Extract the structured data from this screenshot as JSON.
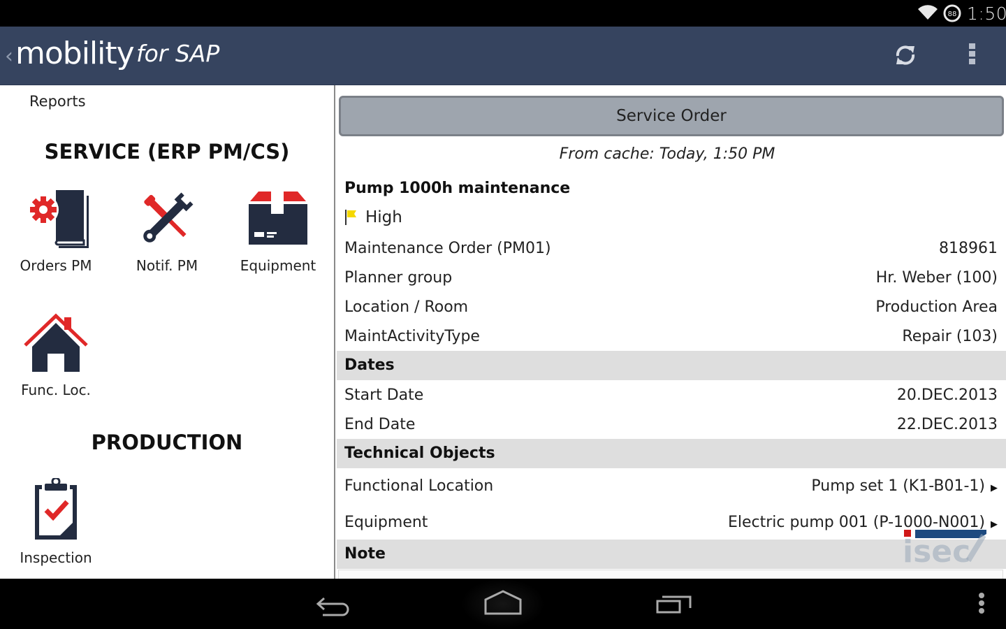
{
  "status_bar": {
    "time": "1:50",
    "battery_level": "88",
    "wifi_icon": "wifi-icon",
    "battery_icon": "battery-circle-icon"
  },
  "action_bar": {
    "back_glyph": "‹",
    "app_name": "mobility",
    "app_suffix": "for SAP",
    "refresh_icon": "refresh-icon",
    "overflow_icon": "more-vertical-icon"
  },
  "left_panel": {
    "reports_label": "Reports",
    "sections": [
      {
        "title": "SERVICE (ERP PM/CS)",
        "tiles": [
          {
            "label": "Orders PM",
            "icon": "orders-gear-book-icon"
          },
          {
            "label": "Notif. PM",
            "icon": "wrench-screwdriver-icon"
          },
          {
            "label": "Equipment",
            "icon": "package-box-icon"
          },
          {
            "label": "Func. Loc.",
            "icon": "house-icon"
          }
        ]
      },
      {
        "title": "PRODUCTION",
        "tiles": [
          {
            "label": "Inspection",
            "icon": "clipboard-check-icon"
          }
        ]
      }
    ]
  },
  "detail": {
    "service_order_button": "Service Order",
    "cache_text": "From cache: Today, 1:50 PM",
    "order_title": "Pump 1000h maintenance",
    "priority": {
      "label": "High",
      "icon": "yellow-flag-icon",
      "color": "#f5d800"
    },
    "fields": [
      {
        "label": "Maintenance Order (PM01)",
        "value": "818961"
      },
      {
        "label": "Planner group",
        "value": "Hr. Weber (100)"
      },
      {
        "label": "Location / Room",
        "value": "Production Area"
      },
      {
        "label": "MaintActivityType",
        "value": "Repair (103)"
      }
    ],
    "sections": {
      "dates": {
        "title": "Dates",
        "fields": [
          {
            "label": "Start Date",
            "value": "20.DEC.2013"
          },
          {
            "label": "End Date",
            "value": "22.DEC.2013"
          }
        ]
      },
      "technical_objects": {
        "title": "Technical Objects",
        "fields": [
          {
            "label": "Functional Location",
            "value": "Pump set 1 (K1-B01-1)",
            "arrow": "▶"
          },
          {
            "label": "Equipment",
            "value": "Electric pump 001 (P-1000-N001)",
            "arrow": "▶"
          }
        ]
      },
      "note": {
        "title": "Note"
      }
    }
  },
  "watermark": {
    "text": "isec"
  },
  "nav_bar": {
    "back_icon": "back-arrow-icon",
    "home_icon": "home-outline-icon",
    "recents_icon": "recent-apps-icon",
    "menu_icon": "menu-dots-icon"
  },
  "colors": {
    "action_bar": "#36445f",
    "icon_navy": "#232c40",
    "icon_red": "#e02828",
    "section_header_bg": "#dedede",
    "button_bg": "#9ea5ae"
  }
}
